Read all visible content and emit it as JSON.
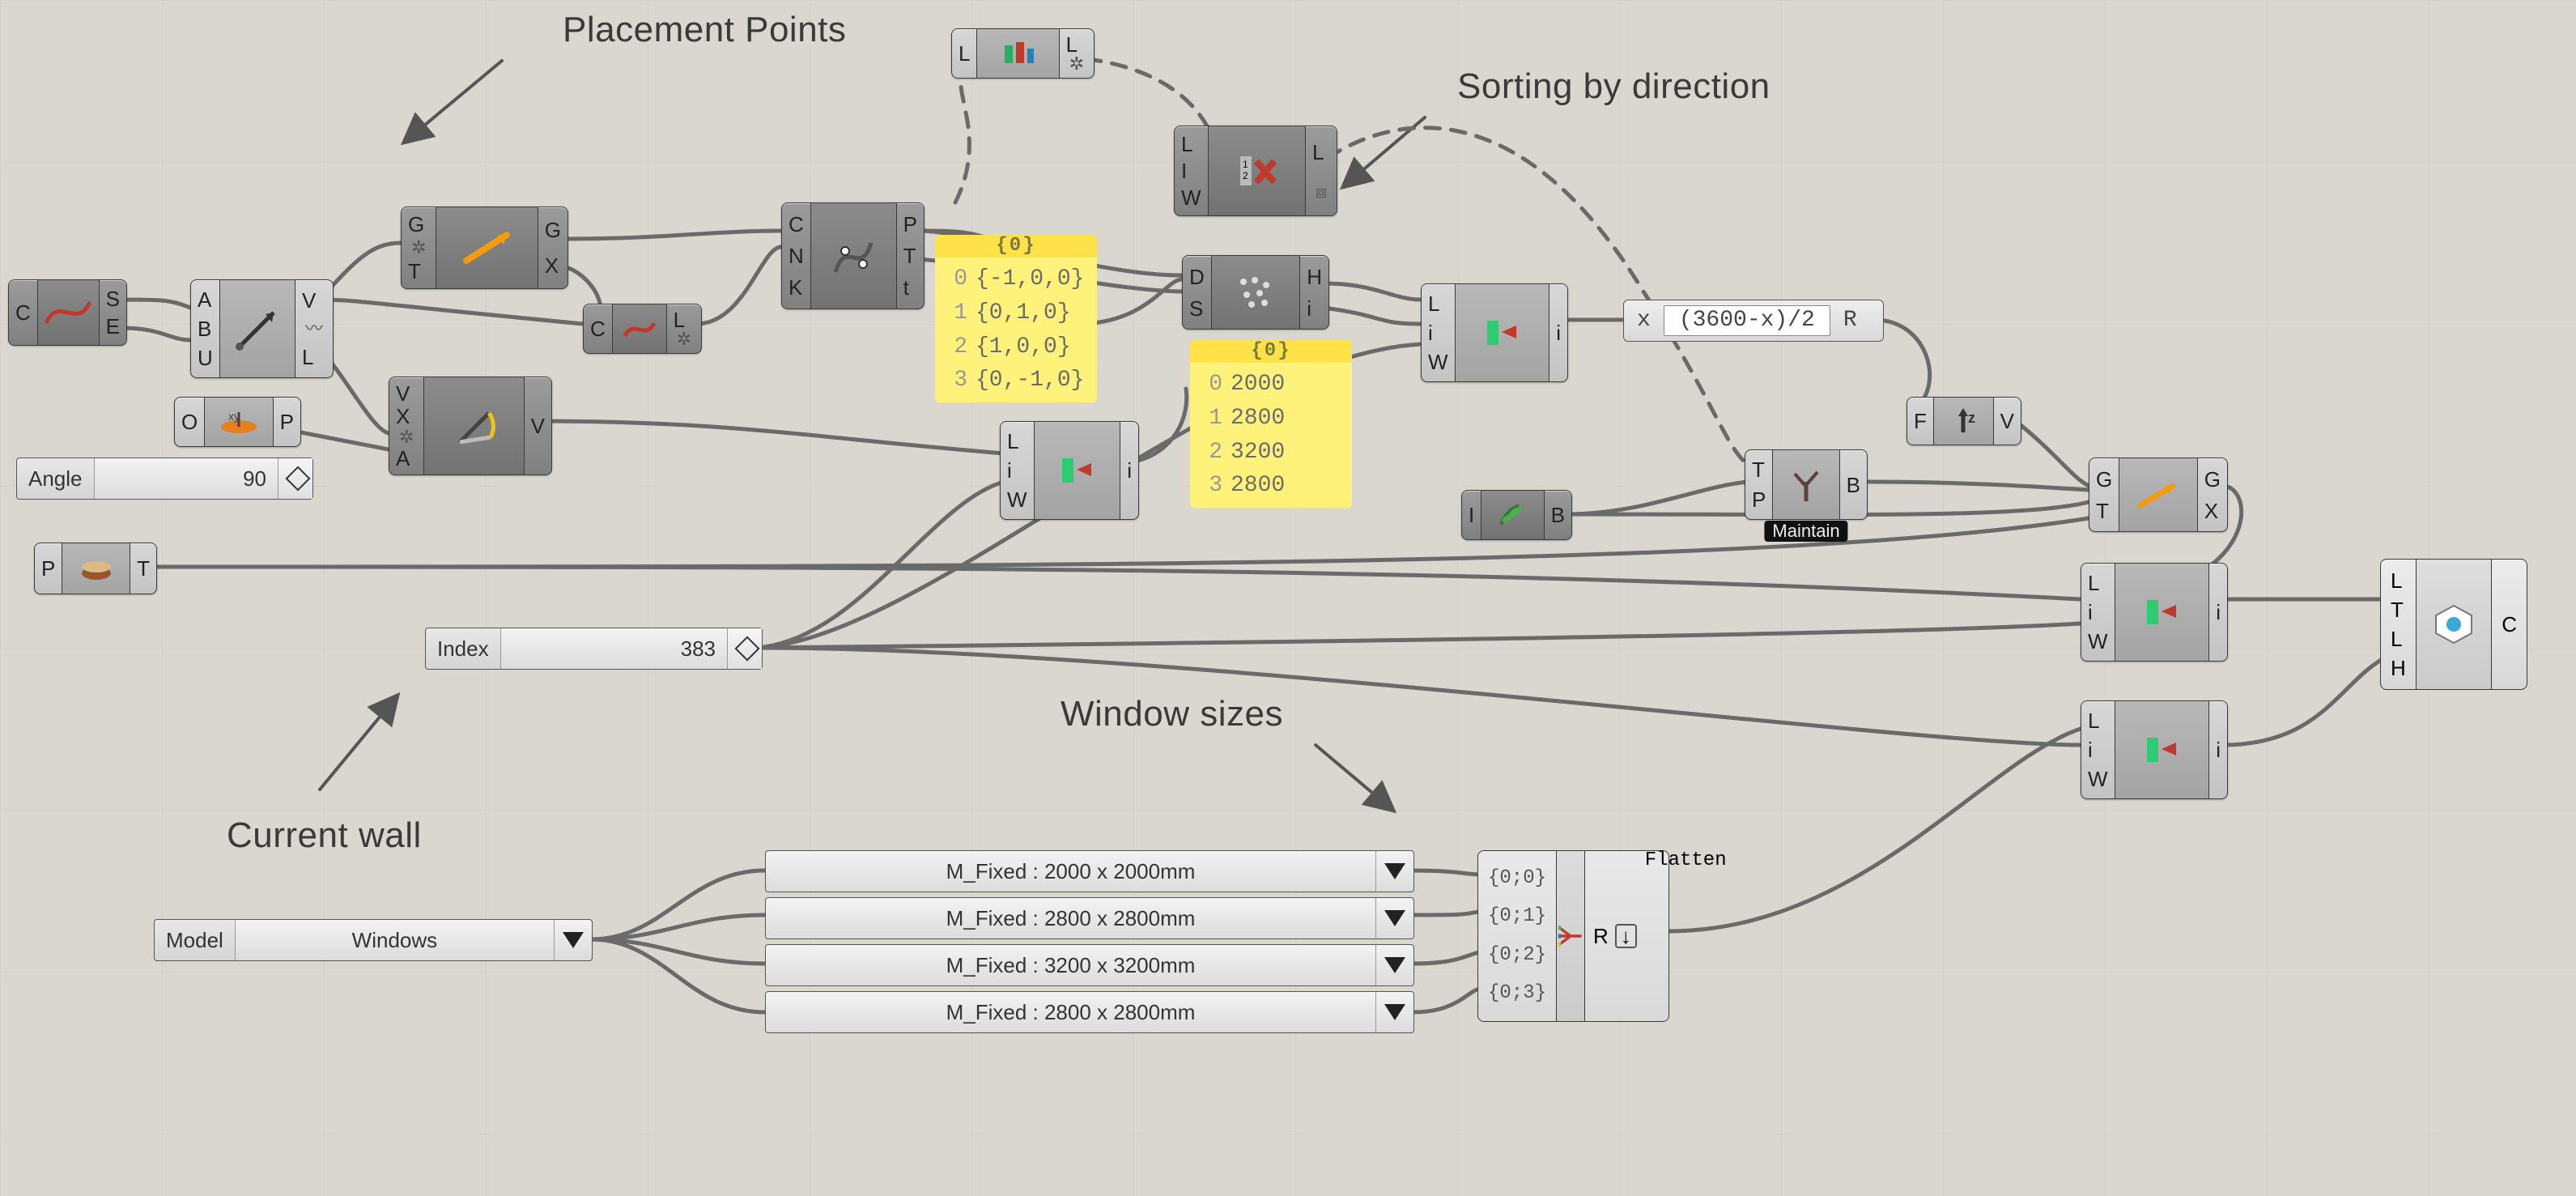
{
  "annotations": {
    "placement_points": "Placement Points",
    "sorting_by_direction": "Sorting by direction",
    "window_sizes": "Window sizes",
    "current_wall": "Current wall"
  },
  "sliders": {
    "angle": {
      "label": "Angle",
      "value": "90"
    },
    "index": {
      "label": "Index",
      "value": "383"
    },
    "model": {
      "label": "Model",
      "value": "Windows"
    }
  },
  "expression": {
    "input": "x",
    "expr": "(3600-x)/2",
    "output": "R"
  },
  "panels": {
    "directions": {
      "title": "{0}",
      "rows": [
        {
          "i": "0",
          "v": "{-1,0,0}"
        },
        {
          "i": "1",
          "v": "{0,1,0}"
        },
        {
          "i": "2",
          "v": "{1,0,0}"
        },
        {
          "i": "3",
          "v": "{0,-1,0}"
        }
      ]
    },
    "sizes": {
      "title": "{0}",
      "rows": [
        {
          "i": "0",
          "v": "2000"
        },
        {
          "i": "1",
          "v": "2800"
        },
        {
          "i": "2",
          "v": "3200"
        },
        {
          "i": "3",
          "v": "2800"
        }
      ]
    }
  },
  "dropdowns": {
    "wt0": "M_Fixed : 2000 x 2000mm",
    "wt1": "M_Fixed : 2800 x 2800mm",
    "wt2": "M_Fixed : 3200 x 3200mm",
    "wt3": "M_Fixed : 2800 x 2800mm"
  },
  "merge": {
    "keys": [
      "{0;0}",
      "{0;1}",
      "{0;2}",
      "{0;3}"
    ],
    "out": "R",
    "tag": "Flatten"
  },
  "tags": {
    "maintain": "Maintain"
  },
  "nodes": {
    "curve": {
      "in": [
        "C"
      ],
      "out": [
        "S",
        "E"
      ]
    },
    "vec2pt": {
      "in": [
        "A",
        "B",
        "U"
      ],
      "out": [
        "V",
        "L"
      ]
    },
    "xyplane": {
      "in": [
        "O"
      ],
      "out": [
        "P"
      ]
    },
    "divide": {
      "in": [
        "G",
        "T"
      ],
      "out": [
        "G",
        "X"
      ]
    },
    "rotvec": {
      "in": [
        "V",
        "X",
        "A"
      ],
      "out": [
        "V"
      ]
    },
    "flip": {
      "in": [
        "C"
      ],
      "out": [
        "L"
      ]
    },
    "evalcrv": {
      "in": [
        "C",
        "N",
        "K"
      ],
      "out": [
        "P",
        "T",
        "t"
      ]
    },
    "graft_top": {
      "in": [
        "L"
      ],
      "out": [
        "L"
      ]
    },
    "listitem1": {
      "in": [
        "L",
        "i",
        "W"
      ],
      "out": [
        "i"
      ]
    },
    "cull": {
      "in": [
        "L",
        "I",
        "W"
      ],
      "out": [
        "L"
      ]
    },
    "sort": {
      "in": [
        "D",
        "S"
      ],
      "out": [
        "H",
        "i"
      ]
    },
    "listitem2": {
      "in": [
        "L",
        "i",
        "W"
      ],
      "out": [
        "i"
      ]
    },
    "zvec": {
      "in": [
        "F"
      ],
      "out": [
        "V"
      ]
    },
    "graft2": {
      "in": [
        "I"
      ],
      "out": [
        "B"
      ]
    },
    "treebranch": {
      "in": [
        "T",
        "P"
      ],
      "out": [
        "B"
      ]
    },
    "treestump": {
      "in": [
        "P"
      ],
      "out": [
        "T"
      ]
    },
    "move": {
      "in": [
        "G",
        "T"
      ],
      "out": [
        "G",
        "X"
      ]
    },
    "listitem3": {
      "in": [
        "L",
        "i",
        "W"
      ],
      "out": [
        "i"
      ]
    },
    "listitem4": {
      "in": [
        "L",
        "i",
        "W"
      ],
      "out": [
        "i"
      ]
    },
    "addhost": {
      "in": [
        "L",
        "T",
        "L",
        "H"
      ],
      "out": [
        "C"
      ]
    }
  }
}
